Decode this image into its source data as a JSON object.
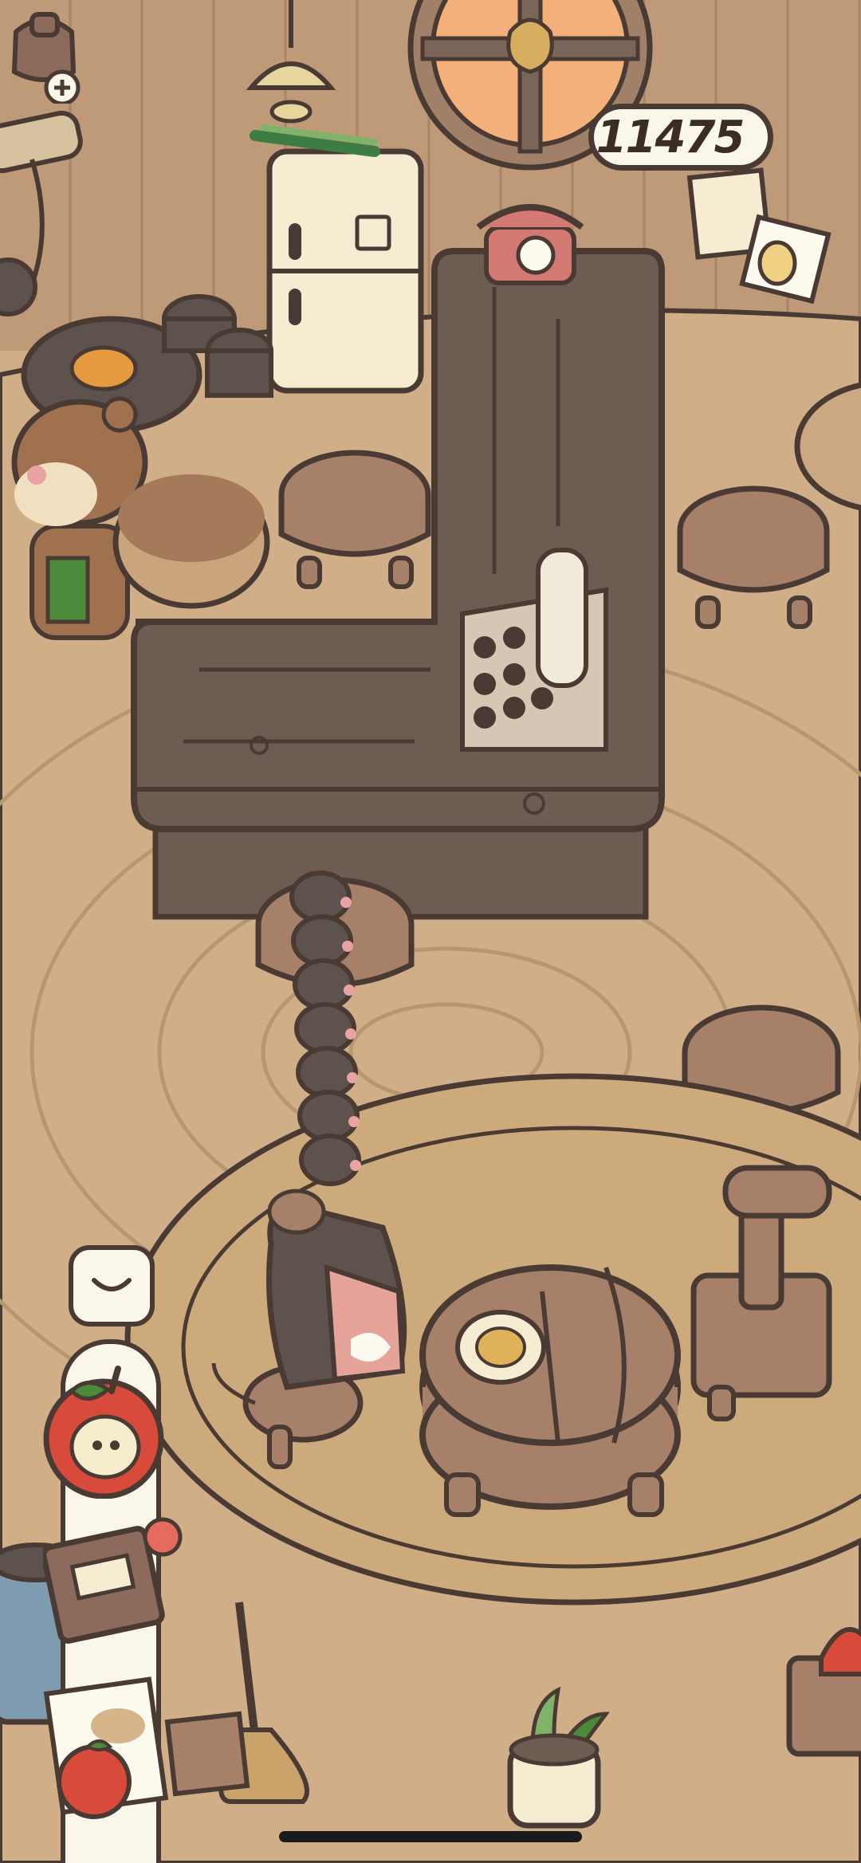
{
  "hud": {
    "coins": "11475"
  },
  "icons": {
    "coin": "coin-bag-icon",
    "add": "plus-icon",
    "collapse": "chevron-down-icon",
    "menu_top": "apple-icon",
    "menu_middle": "recipe-notebook-icon",
    "menu_bottom": "apple-letter-icon"
  },
  "palette": {
    "wood_dark": "#6e5c52",
    "wood_light": "#a68068",
    "floor": "#cfae88",
    "rug": "#cdaa7b",
    "outline": "#4a3a34",
    "cream": "#fbf6ea",
    "red": "#d84a3a"
  }
}
